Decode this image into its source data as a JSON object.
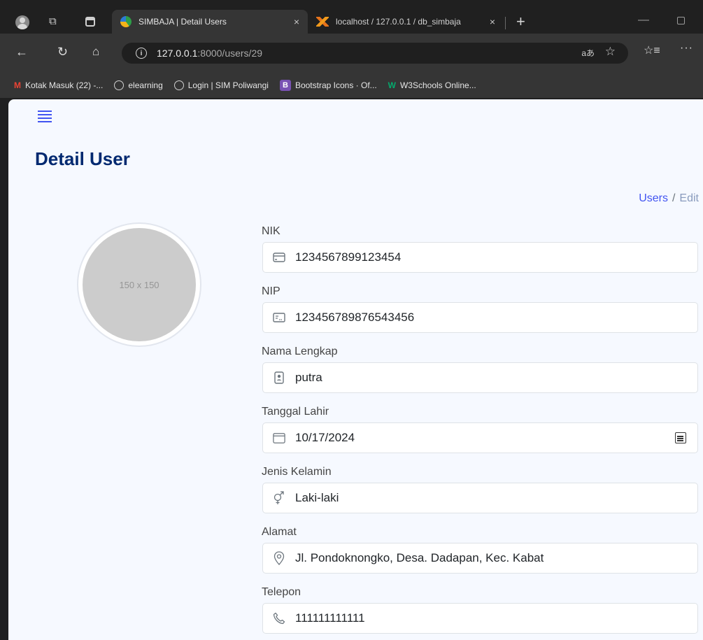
{
  "browser": {
    "tabs": [
      {
        "title": "SIMBAJA | Detail Users",
        "close": "×"
      },
      {
        "title": "localhost / 127.0.0.1 / db_simbaja",
        "close": "×"
      }
    ],
    "new_tab": "+",
    "url_host": "127.0.0.1",
    "url_rest": ":8000/users/29",
    "translate": "aあ"
  },
  "bookmarks": [
    {
      "label": "Kotak Masuk (22) -...",
      "icon": "gmail-icon"
    },
    {
      "label": "elearning",
      "icon": "globe-icon"
    },
    {
      "label": "Login | SIM Poliwangi",
      "icon": "globe-icon"
    },
    {
      "label": "Bootstrap Icons · Of...",
      "icon": "bootstrap-icon"
    },
    {
      "label": "W3Schools Online...",
      "icon": "w3schools-icon"
    }
  ],
  "page": {
    "title": "Detail User",
    "breadcrumb": {
      "link": "Users",
      "sep": "/",
      "current": "Edit"
    },
    "avatar_text": "150 x 150"
  },
  "form": {
    "nik": {
      "label": "NIK",
      "value": "1234567899123454"
    },
    "nip": {
      "label": "NIP",
      "value": "123456789876543456"
    },
    "nama": {
      "label": "Nama Lengkap",
      "value": "putra"
    },
    "tanggal": {
      "label": "Tanggal Lahir",
      "value": "10/17/2024"
    },
    "jenis": {
      "label": "Jenis Kelamin",
      "value": "Laki-laki"
    },
    "alamat": {
      "label": "Alamat",
      "value": "Jl. Pondoknongko, Desa. Dadapan, Kec. Kabat"
    },
    "telepon": {
      "label": "Telepon",
      "value": "111111111111"
    }
  },
  "colors": {
    "accent": "#4154f1",
    "title": "#012970",
    "page_bg": "#f6f9ff"
  }
}
